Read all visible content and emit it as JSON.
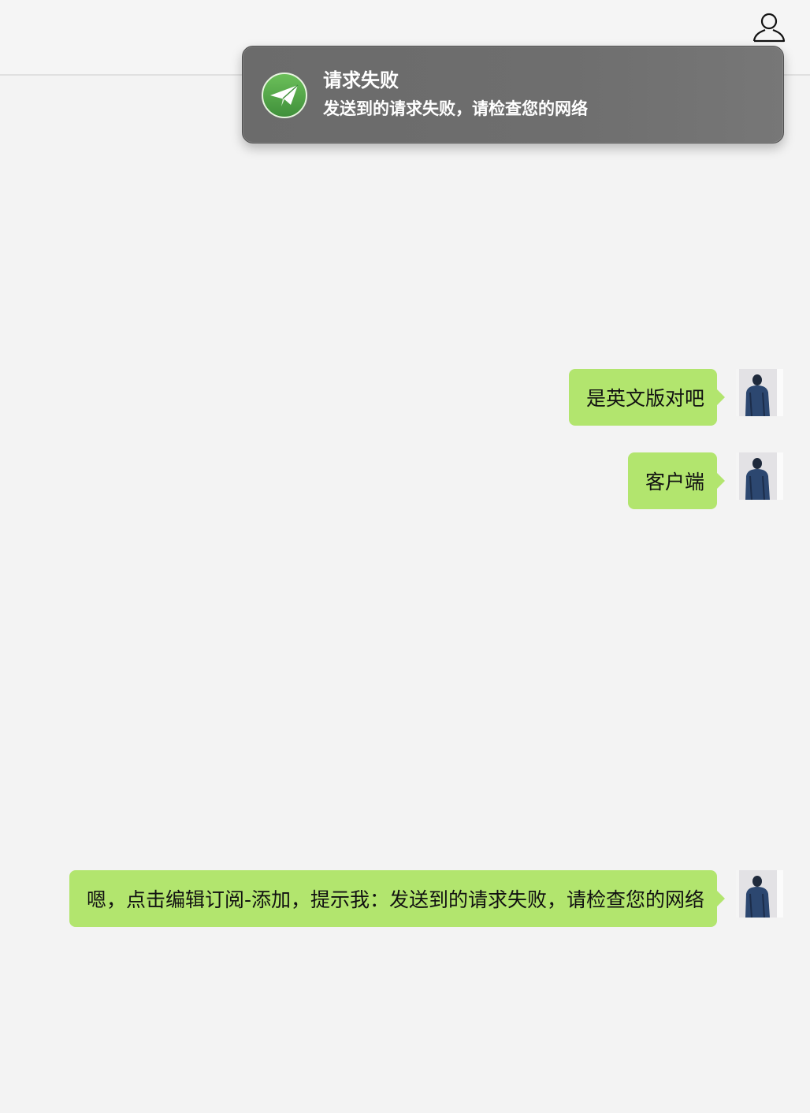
{
  "toast": {
    "title": "请求失败",
    "body": "发送到的请求失败，请检查您的网络",
    "icon": "paper-plane-icon",
    "icon_color": "#5aa54a"
  },
  "header": {
    "profile_icon": "user-outline-icon"
  },
  "messages": [
    {
      "text": "是英文版对吧",
      "sender": "self"
    },
    {
      "text": "客户端",
      "sender": "self"
    },
    {
      "text": "嗯，点击编辑订阅-添加，提示我：发送到的请求失败，请检查您的网络",
      "sender": "self"
    }
  ],
  "colors": {
    "bubble": "#b2e56e",
    "background": "#f3f3f3",
    "toast_background": "#6e6e6e"
  }
}
